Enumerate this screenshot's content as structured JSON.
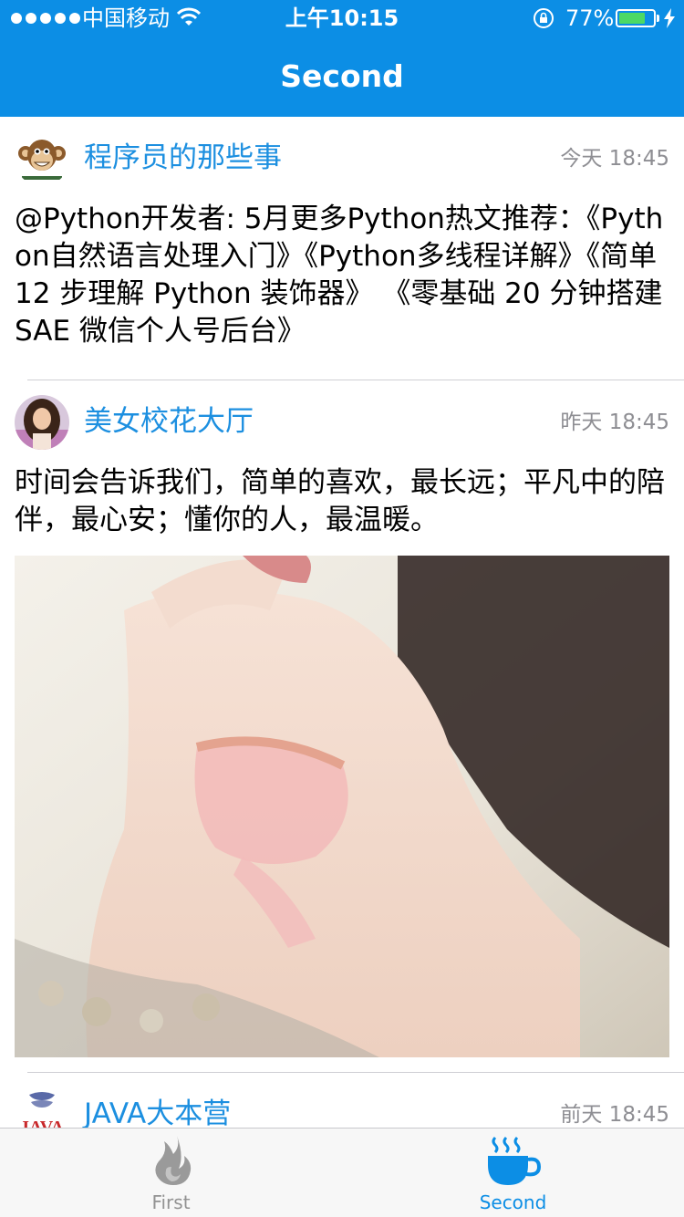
{
  "status_bar": {
    "carrier": "中国移动",
    "time": "上午10:15",
    "battery_percent": "77%",
    "battery_level": 0.77
  },
  "nav": {
    "title": "Second"
  },
  "posts": [
    {
      "username": "程序员的那些事",
      "time": "今天 18:45",
      "text": "@Python开发者: 5月更多Python热文推荐：《Python自然语言处理入门》《Python多线程详解》《简单 12 步理解 Python 装饰器》 《零基础 20 分钟搭建 SAE 微信个人号后台》"
    },
    {
      "username": "美女校花大厅",
      "time": "昨天 18:45",
      "text": "时间会告诉我们，简单的喜欢，最长远；平凡中的陪伴，最心安；懂你的人，最温暖。"
    },
    {
      "username": "JAVA大本营",
      "time": "前天 18:45",
      "avatar_text": "JAVA"
    }
  ],
  "tabs": [
    {
      "label": "First",
      "icon": "flame-icon",
      "selected": false
    },
    {
      "label": "Second",
      "icon": "coffee-cup-icon",
      "selected": true
    }
  ],
  "colors": {
    "accent": "#0c8ee5",
    "username": "#1c8fe0",
    "timestamp": "#8e8e93",
    "tab_inactive": "#929292"
  }
}
